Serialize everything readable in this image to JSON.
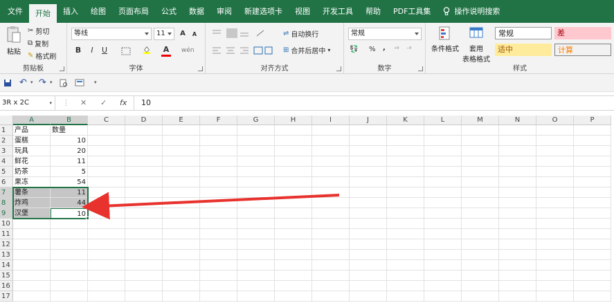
{
  "tabs": [
    "文件",
    "开始",
    "插入",
    "绘图",
    "页面布局",
    "公式",
    "数据",
    "审阅",
    "新建选项卡",
    "视图",
    "开发工具",
    "帮助",
    "PDF工具集"
  ],
  "active_tab": "开始",
  "search_label": "操作说明搜索",
  "ribbon": {
    "clipboard": {
      "paste": "粘贴",
      "cut": "剪切",
      "copy": "复制",
      "format_painter": "格式刷",
      "label": "剪贴板"
    },
    "font": {
      "name": "等线",
      "size": "11",
      "grow": "A",
      "shrink": "A",
      "bold": "B",
      "italic": "I",
      "underline": "U",
      "label": "字体",
      "wen": "wén"
    },
    "alignment": {
      "wrap": "自动换行",
      "merge": "合并后居中",
      "label": "对齐方式"
    },
    "number": {
      "format": "常规",
      "percent": "%",
      "comma": ",",
      "label": "数字"
    },
    "styles": {
      "cond": "条件格式",
      "table1": "套用",
      "table2": "表格格式",
      "normal": "常规",
      "bad": "差",
      "neutral": "适中",
      "calc": "计算",
      "label": "样式"
    },
    "colors": {
      "bad_bg": "#ffc7ce",
      "bad_fg": "#9c0006",
      "neutral_bg": "#ffeb9c",
      "neutral_fg": "#9c5700",
      "calc_bg": "#f2f2f2",
      "calc_fg": "#fa7d00"
    }
  },
  "formula_bar": {
    "name_box": "3R x 2C",
    "fx": "fx",
    "value": "10"
  },
  "columns": [
    "A",
    "B",
    "C",
    "D",
    "E",
    "F",
    "G",
    "H",
    "I",
    "J",
    "K",
    "L",
    "M",
    "N",
    "O",
    "P"
  ],
  "rows": [
    "1",
    "2",
    "3",
    "4",
    "5",
    "6",
    "7",
    "8",
    "9",
    "10",
    "11",
    "12",
    "13",
    "14",
    "15",
    "16",
    "17"
  ],
  "table": [
    {
      "a": "产品",
      "b": "数量"
    },
    {
      "a": "蛋糕",
      "b": "10"
    },
    {
      "a": "玩具",
      "b": "20"
    },
    {
      "a": "鲜花",
      "b": "11"
    },
    {
      "a": "奶茶",
      "b": "5"
    },
    {
      "a": "果冻",
      "b": "54"
    },
    {
      "a": "薯条",
      "b": "11"
    },
    {
      "a": "炸鸡",
      "b": "44"
    },
    {
      "a": "汉堡",
      "b": "10"
    }
  ],
  "accent": "#217346",
  "arrow_color": "#e8322e"
}
